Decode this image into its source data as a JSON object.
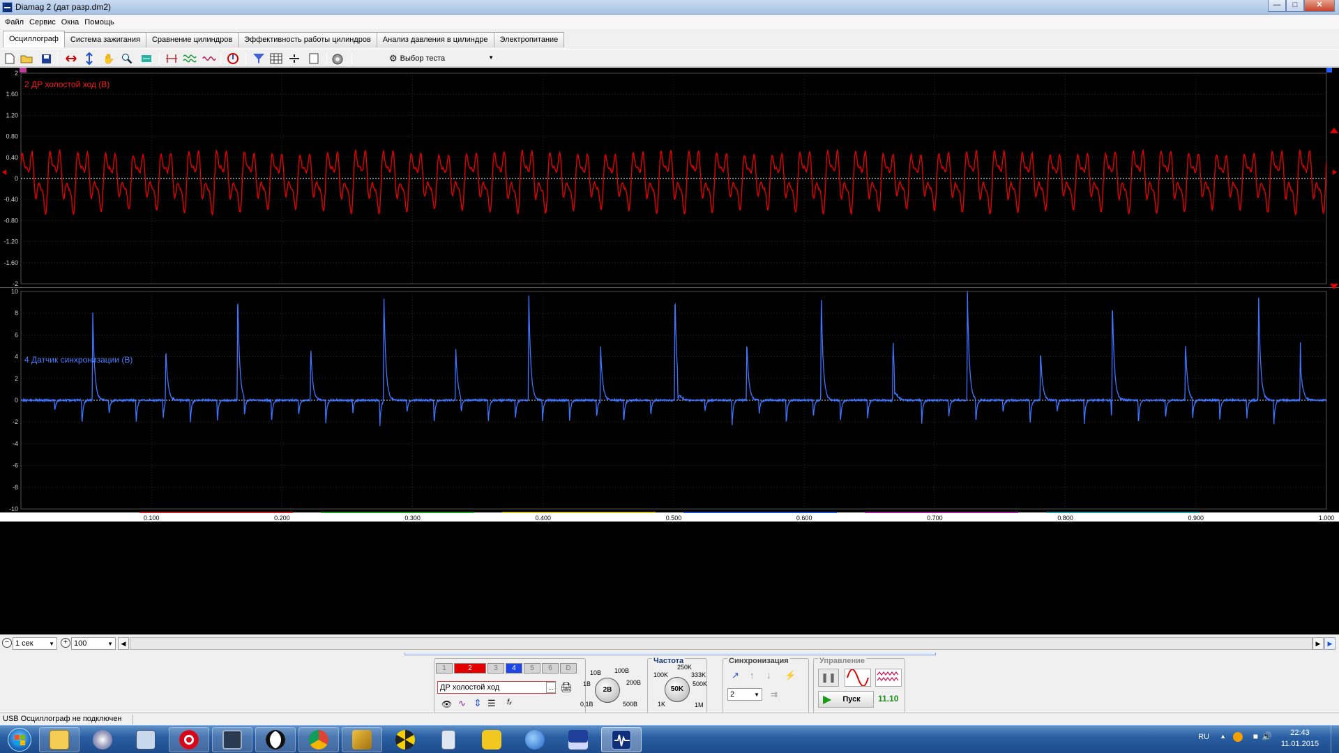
{
  "window": {
    "title": "Diamag 2 (дат разр.dm2)"
  },
  "menu": [
    "Файл",
    "Сервис",
    "Окна",
    "Помощь"
  ],
  "tabs": [
    {
      "label": "Осциллограф",
      "active": true
    },
    {
      "label": "Система зажигания"
    },
    {
      "label": "Сравнение цилиндров"
    },
    {
      "label": "Эффективность работы цилиндров"
    },
    {
      "label": "Анализ давления в цилиндре"
    },
    {
      "label": "Электропитание"
    }
  ],
  "toolbar": {
    "test_select": "Выбор теста",
    "icons": [
      "new-file-icon",
      "open-folder-icon",
      "save-icon",
      "zoom-horizontal-icon",
      "zoom-vertical-icon",
      "hand-icon",
      "magnifier-icon",
      "fit-icon",
      "cursors-icon",
      "filter-icon",
      "overlay-icon",
      "auto-icon",
      "channel-select-icon",
      "table-icon",
      "marker-icon",
      "page-icon",
      "auto-setup-icon"
    ]
  },
  "chart_data": [
    {
      "type": "line",
      "title": "2 ДР холостой ход (В)",
      "color": "#e00000",
      "ylim": [
        -2,
        2
      ],
      "y_ticks": [
        "2",
        "1.60",
        "1.20",
        "0.80",
        "0.40",
        "0",
        "-0.40",
        "-0.80",
        "-1.20",
        "-1.60",
        "-2"
      ],
      "xlim": [
        0,
        1.0
      ],
      "description_series": {
        "name": "2 ДР холостой ход (В)",
        "peak_max": 0.75,
        "peak_min": -0.7,
        "cycles": 47
      }
    },
    {
      "type": "line",
      "title": "4 Датчик синхронизации (В)",
      "color": "#2f6bff",
      "ylim": [
        -10,
        10
      ],
      "y_ticks": [
        "10",
        "8",
        "6",
        "4",
        "2",
        "0",
        "-2",
        "-4",
        "-6",
        "-8",
        "-10"
      ],
      "xlim": [
        0,
        1.0
      ],
      "x_ticks": [
        "0.100",
        "0.200",
        "0.300",
        "0.400",
        "0.500",
        "0.600",
        "0.700",
        "0.800",
        "0.900",
        "1.000"
      ],
      "tall_spikes": {
        "x": [
          0.055,
          0.166,
          0.278,
          0.389,
          0.501,
          0.613,
          0.725,
          0.836,
          0.948
        ],
        "y": [
          8.0,
          10.0,
          10.0,
          10.0,
          10.0,
          9.8,
          10.0,
          10.0,
          10.0
        ]
      },
      "short_spikes": {
        "x": [
          0.111,
          0.222,
          0.333,
          0.444,
          0.556,
          0.668,
          0.781,
          0.892,
          0.98
        ],
        "y": [
          5.0,
          5.0,
          5.0,
          5.2,
          5.5,
          5.6,
          4.6,
          5.5,
          5.3
        ]
      }
    }
  ],
  "time_controls": {
    "timebase": "1 сек",
    "zoom": "100"
  },
  "channels": {
    "buttons": [
      "1",
      "2",
      "3",
      "4",
      "5",
      "6",
      "D"
    ],
    "active": [
      "2",
      "4"
    ],
    "name_field": "ДР холостой ход",
    "name_field_more": "...",
    "volt_knob": {
      "value": "2В",
      "labels": [
        "10В",
        "100В",
        "1В",
        "200В",
        "0,1В",
        "500В"
      ]
    }
  },
  "frequency": {
    "title": "Частота",
    "value": "50K",
    "labels": [
      "250K",
      "100K",
      "333K",
      "500K",
      "1K",
      "1M"
    ]
  },
  "sync": {
    "title": "Синхронизация",
    "channel": "2"
  },
  "control": {
    "title": "Управление",
    "start_label": "Пуск",
    "version": "11.10"
  },
  "status": {
    "text": "USB Осциллограф не подключен"
  },
  "taskbar": {
    "apps": [
      "explorer",
      "media",
      "keyboard",
      "opera",
      "computer",
      "panda",
      "chrome",
      "tool",
      "radiation",
      "calculator",
      "ask",
      "globe",
      "floppy",
      "diamag"
    ],
    "lang": "RU",
    "time": "22:43",
    "date": "11.01.2015"
  }
}
